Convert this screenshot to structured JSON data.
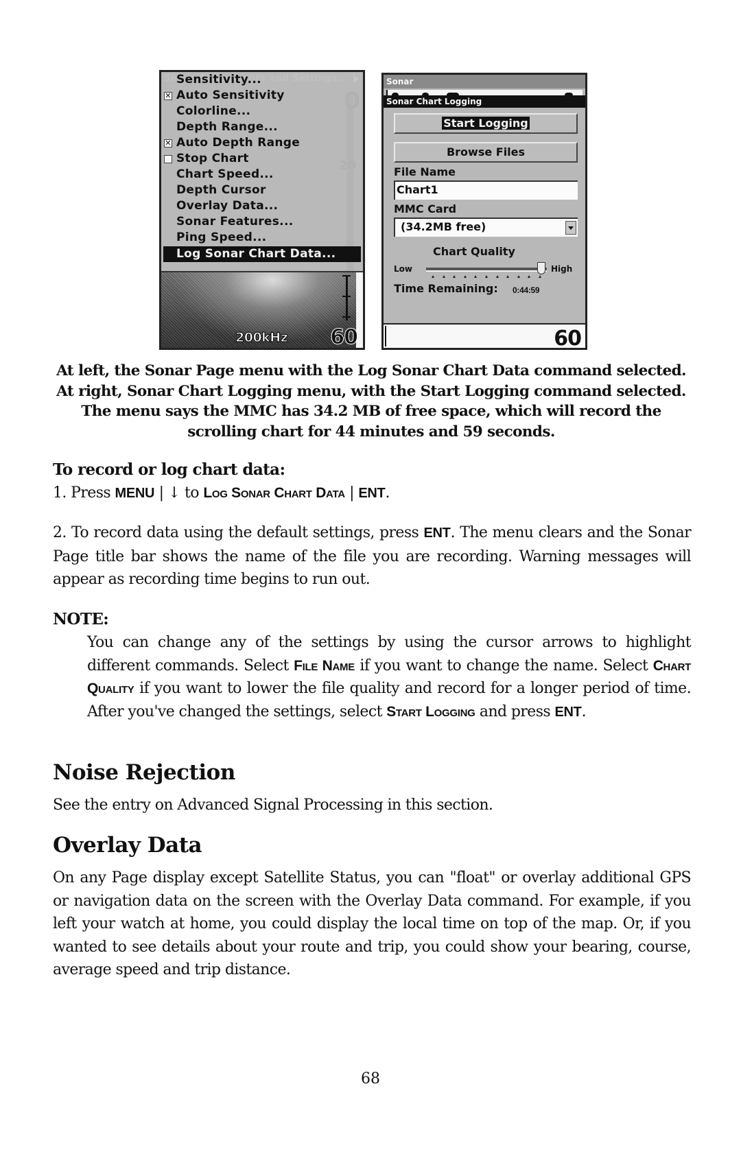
{
  "left_screen": {
    "background_title": "Sonar Adjustments and Settings...",
    "menu_items": [
      {
        "label": "Sensitivity...",
        "checkbox": null
      },
      {
        "label": "Auto Sensitivity",
        "checkbox": "checked"
      },
      {
        "label": "Colorline...",
        "checkbox": null
      },
      {
        "label": "Depth Range...",
        "checkbox": null
      },
      {
        "label": "Auto Depth Range",
        "checkbox": "checked"
      },
      {
        "label": "Stop Chart",
        "checkbox": "unchecked"
      },
      {
        "label": "Chart Speed...",
        "checkbox": null
      },
      {
        "label": "Depth Cursor",
        "checkbox": null
      },
      {
        "label": "Overlay Data...",
        "checkbox": null
      },
      {
        "label": "Sonar Features...",
        "checkbox": null
      },
      {
        "label": "Ping Speed...",
        "checkbox": null
      },
      {
        "label": "Log Sonar Chart Data...",
        "checkbox": null,
        "selected": true
      }
    ],
    "check_mark": "✕",
    "ghost_scale_top": "0",
    "ghost_scale_mid": "20",
    "frequency": "200kHz",
    "depth": "60"
  },
  "right_screen": {
    "page_title": "Sonar",
    "dialog_title": "Sonar Chart Logging",
    "start_logging_label": "Start Logging",
    "browse_files_label": "Browse Files",
    "file_name_label": "File Name",
    "file_name_value": "Chart1",
    "mmc_card_label": "MMC Card",
    "mmc_card_value": "(34.2MB free)",
    "chart_quality_label": "Chart Quality",
    "slider_low": "Low",
    "slider_high": "High",
    "chart_quality_level": 10,
    "chart_quality_max": 10,
    "time_remaining_label": "Time Remaining:",
    "time_remaining_value": "0:44:59",
    "depth": "60"
  },
  "caption": "At left, the Sonar Page menu with the Log Sonar Chart Data command selected. At right, Sonar Chart Logging menu, with the Start Logging command selected. The menu says the MMC has 34.2 MB of free space, which will record the scrolling chart for 44 minutes and 59 seconds.",
  "procedure": {
    "heading": "To record or log chart data:",
    "step1": {
      "prefix": "1. Press ",
      "key_menu": "MENU",
      "sep1": " | ",
      "arrow": "↓",
      "to": " to ",
      "command": "Log Sonar Chart Data",
      "sep2": " | ",
      "key_ent": "ENT",
      "suffix": "."
    },
    "step2": {
      "prefix": "2. To record data using the default settings, press ",
      "key_ent": "ENT",
      "suffix": ". The menu clears and the Sonar Page title bar shows the name of the file you are recording. Warning messages will appear as recording time begins to run out."
    }
  },
  "note": {
    "heading": "NOTE:",
    "part1": "You can change any of the settings by using the cursor arrows to highlight different commands. Select ",
    "cmd_file_name": "File Name",
    "part2": " if you want to change the name. Select ",
    "cmd_chart_quality": "Chart Quality",
    "part3": " if you want to lower the file quality and record for a longer period of time. After you've changed the settings, select ",
    "cmd_start_logging": "Start Logging",
    "part4": " and press ",
    "key_ent": "ENT",
    "part5": "."
  },
  "noise_rejection": {
    "heading": "Noise Rejection",
    "body": "See the entry on Advanced Signal Processing in this section."
  },
  "overlay_data": {
    "heading": "Overlay Data",
    "body": "On any Page display except Satellite Status, you can \"float\" or overlay additional GPS or navigation data on the screen with the Overlay Data command. For example, if you left your watch at home, you could display the local time on top of the map. Or, if you wanted to see details about your route and trip, you could show your bearing, course, average speed and trip distance."
  },
  "page_number": "68"
}
